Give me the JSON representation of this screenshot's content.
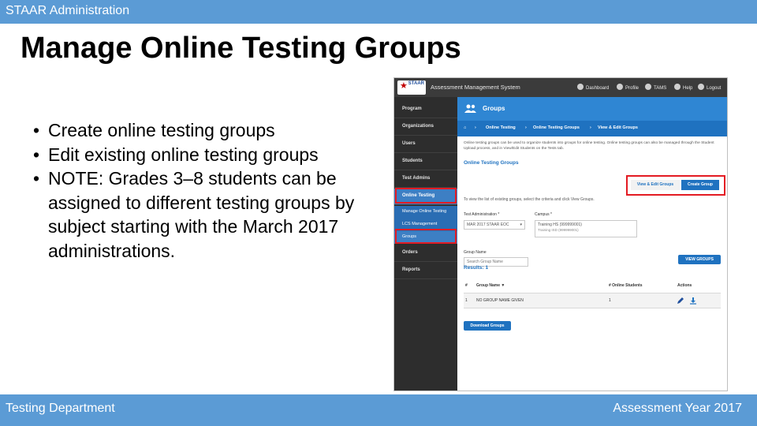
{
  "header": {
    "title": "STAAR Administration"
  },
  "slide": {
    "title": "Manage Online Testing Groups",
    "bullets": [
      "Create online testing groups",
      "Edit existing online testing groups",
      "NOTE: Grades 3–8 students can be assigned to different testing groups by subject starting with the March 2017 administrations."
    ]
  },
  "footer": {
    "left": "Testing Department",
    "right": "Assessment Year 2017"
  },
  "colors": {
    "accent": "#5b9bd5",
    "app_blue": "#2f86d3",
    "highlight_red": "#e31b23"
  },
  "app": {
    "logo_text": "STAAR",
    "title": "Assessment Management System",
    "header_items": [
      {
        "icon": "dashboard-icon",
        "label": "Dashboard"
      },
      {
        "icon": "user-icon",
        "label": "Profile"
      },
      {
        "icon": "signpost-icon",
        "label": "TAMS"
      },
      {
        "icon": "help-icon",
        "label": "Help"
      },
      {
        "icon": "logout-icon",
        "label": "Logout"
      }
    ],
    "sidebar": {
      "items": [
        "Program",
        "Organizations",
        "Users",
        "Students",
        "Test Admins",
        "Online Testing"
      ],
      "subitems": [
        "Manage Online Testing",
        "LCS Management",
        "Groups"
      ],
      "bottom_items": [
        "Orders",
        "Reports"
      ]
    },
    "page_title": "Groups",
    "breadcrumbs": [
      "Online Testing",
      "Online Testing Groups",
      "View & Edit Groups"
    ],
    "intro": "Online testing groups can be used to organize students into groups for online testing. Online testing groups can also be managed through the Student Upload process, and in View/Edit Students on the Tests tab.",
    "section_title": "Online Testing Groups",
    "tabs": {
      "view_edit": "View & Edit Groups",
      "create": "Create Group"
    },
    "hint": "To view the list of existing groups, select the criteria and click View Groups.",
    "form": {
      "test_admin_label": "Test Administration *",
      "test_admin_value": "MAR 2017 STAAR EOC",
      "campus_label": "Campus *",
      "campus_value": "Training HS (999999001)",
      "campus_sub": "Training ISD (999999001)",
      "group_name_label": "Group Name",
      "group_name_placeholder": "Search Group Name"
    },
    "view_groups_button": "VIEW GROUPS",
    "results_label": "Results: 1",
    "table": {
      "columns": [
        "#",
        "Group Name",
        "# Online Students",
        "Actions"
      ],
      "rows": [
        {
          "index": "1",
          "group_name": "NO GROUP NAME GIVEN",
          "students": "1"
        }
      ]
    },
    "download_button": "Download Groups"
  }
}
